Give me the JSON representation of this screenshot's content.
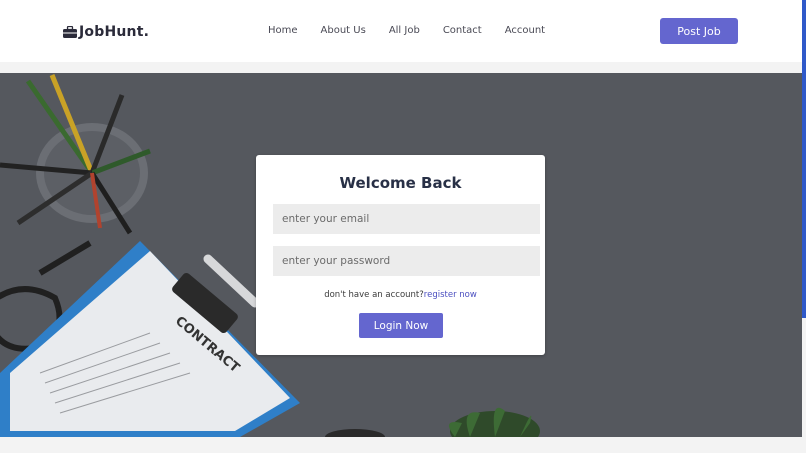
{
  "header": {
    "logo_text": "JobHunt.",
    "logo_icon": "briefcase-icon",
    "nav": [
      "Home",
      "About Us",
      "All Job",
      "Contact",
      "Account"
    ],
    "post_job_label": "Post Job"
  },
  "login": {
    "title": "Welcome Back",
    "email_placeholder": "enter your email",
    "password_placeholder": "enter your password",
    "register_prompt": "don't have an account?",
    "register_link": "register now",
    "login_button": "Login Now"
  },
  "hero": {
    "background_image": "desk with pencil cup, glasses, contract clipboard, plant",
    "clipboard_text": "CONTRACT"
  },
  "colors": {
    "accent": "#6466cf",
    "title": "#283046",
    "hero_overlay": "#55585e"
  }
}
